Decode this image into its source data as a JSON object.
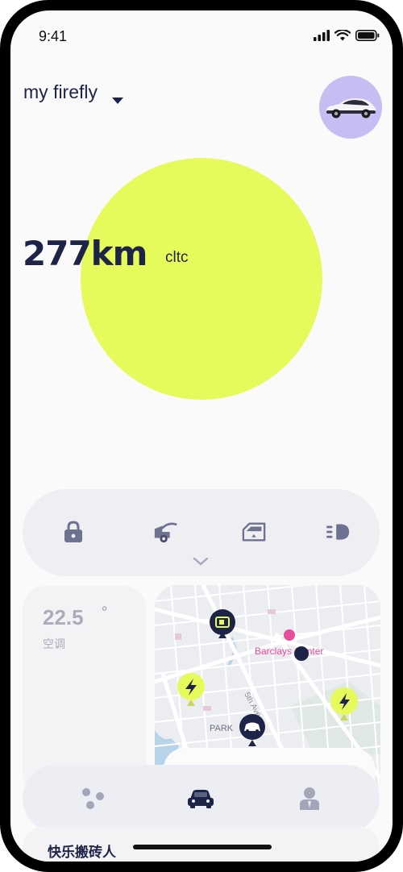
{
  "status_bar": {
    "time": "9:41"
  },
  "header": {
    "car_name": "my firefly"
  },
  "range": {
    "value": "277km",
    "unit": "cltc"
  },
  "controls": [
    {
      "icon": "lock-icon"
    },
    {
      "icon": "trunk-icon"
    },
    {
      "icon": "window-icon"
    },
    {
      "icon": "headlight-icon"
    }
  ],
  "climate": {
    "temperature": "22.5",
    "degree": "°",
    "label": "空调"
  },
  "map": {
    "place_label": "Barclays Center",
    "street_label": "5th Ave",
    "area_label": "PARK"
  },
  "tabs": [
    {
      "icon": "dots-icon"
    },
    {
      "icon": "car-icon"
    },
    {
      "icon": "profile-icon"
    }
  ],
  "bottom_card": {
    "title": "快乐搬砖人"
  },
  "colors": {
    "accent": "#e6fb5b",
    "brand": "#1e2348",
    "avatar_bg": "#c8bdf2"
  }
}
